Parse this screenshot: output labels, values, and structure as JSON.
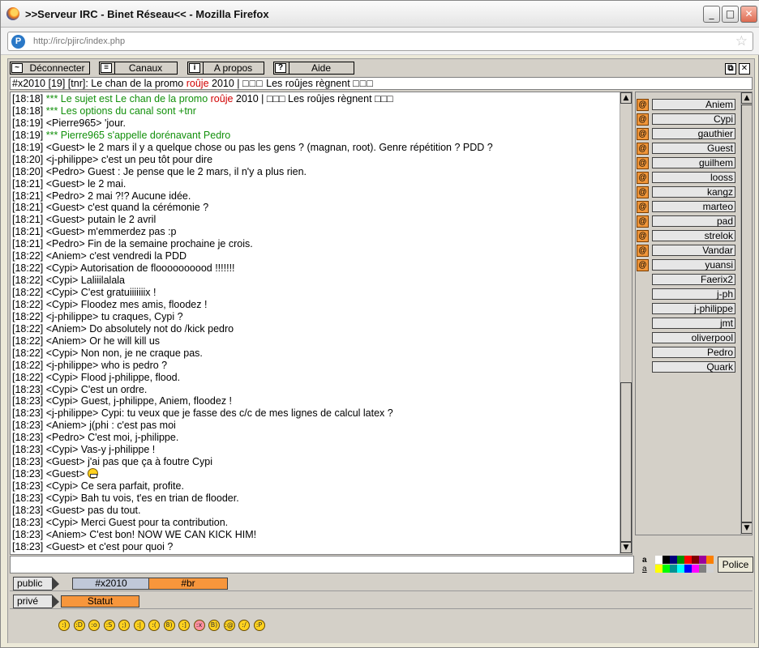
{
  "window": {
    "title": ">>Serveur IRC - Binet Réseau<< - Mozilla Firefox",
    "minimize": "_",
    "maximize": "□",
    "close": "✕"
  },
  "addressbar": {
    "favicon": "P",
    "url": "http://irc/pjirc/index.php",
    "bookmark_star": "☆"
  },
  "toolbar": {
    "buttons": [
      {
        "label": "Déconnecter",
        "icon": "~",
        "icon_name": "disconnect-icon"
      },
      {
        "label": "Canaux",
        "icon": "≡",
        "icon_name": "channels-icon"
      },
      {
        "label": "A propos",
        "icon": "i",
        "icon_name": "info-icon"
      },
      {
        "label": "Aide",
        "icon": "?",
        "icon_name": "help-icon"
      }
    ],
    "restore": "⧉",
    "close": "✕"
  },
  "topic": {
    "prefix": "#x2010 [19] [tnr]: Le chan de la promo ",
    "highlight": "roûje",
    "middle": " 2010 | ",
    "boxes1": "□□□",
    "suffix": " Les roûjes règnent ",
    "boxes2": "□□□"
  },
  "chat": {
    "lines": [
      {
        "time": "[18:18]",
        "text": "*** Le sujet est Le chan de la promo ",
        "highlight": "roûje",
        "text2": " 2010 | □□□ Les roûjes règnent □□□",
        "system": true
      },
      {
        "time": "[18:18]",
        "text": "*** Les options du canal sont +tnr",
        "system": true
      },
      {
        "time": "[18:19]",
        "text": "<Pierre965> 'jour."
      },
      {
        "time": "[18:19]",
        "text": "*** Pierre965 s'appelle dorénavant Pedro",
        "system": true
      },
      {
        "time": "[18:19]",
        "text": "<Guest> le 2 mars il y a quelque chose ou pas les gens ? (magnan, root). Genre répétition ? PDD ?"
      },
      {
        "time": "[18:20]",
        "text": "<j-philippe> c'est un peu tôt pour dire"
      },
      {
        "time": "[18:20]",
        "text": "<Pedro> Guest : Je pense que le 2 mars, il n'y a plus rien."
      },
      {
        "time": "[18:21]",
        "text": "<Guest> le 2 mai."
      },
      {
        "time": "[18:21]",
        "text": "<Pedro> 2 mai ?!? Aucune idée."
      },
      {
        "time": "[18:21]",
        "text": "<Guest> c'est quand la cérémonie ?"
      },
      {
        "time": "[18:21]",
        "text": "<Guest> putain le 2 avril"
      },
      {
        "time": "[18:21]",
        "text": "<Guest> m'emmerdez pas :p"
      },
      {
        "time": "[18:21]",
        "text": "<Pedro> Fin de la semaine prochaine je crois."
      },
      {
        "time": "[18:22]",
        "text": "<Aniem> c'est vendredi la PDD"
      },
      {
        "time": "[18:22]",
        "text": "<Cypi> Autorisation de floooooooood !!!!!!!"
      },
      {
        "time": "[18:22]",
        "text": "<Cypi> Laliiilalala"
      },
      {
        "time": "[18:22]",
        "text": "<Cypi> C'est gratuiiiiiiix !"
      },
      {
        "time": "[18:22]",
        "text": "<Cypi> Floodez mes amis, floodez !"
      },
      {
        "time": "[18:22]",
        "text": "<j-philippe> tu craques, Cypi ?"
      },
      {
        "time": "[18:22]",
        "text": "<Aniem> Do absolutely not do /kick pedro"
      },
      {
        "time": "[18:22]",
        "text": "<Aniem> Or he will kill us"
      },
      {
        "time": "[18:22]",
        "text": "<Cypi> Non non, je ne craque pas."
      },
      {
        "time": "[18:22]",
        "text": "<j-philippe> who is pedro ?"
      },
      {
        "time": "[18:22]",
        "text": "<Cypi> Flood j-philippe, flood."
      },
      {
        "time": "[18:23]",
        "text": "<Cypi> C'est un ordre."
      },
      {
        "time": "[18:23]",
        "text": "<Cypi> Guest, j-philippe, Aniem, floodez !"
      },
      {
        "time": "[18:23]",
        "text": "<j-philippe> Cypi: tu veux que je fasse des c/c de mes lignes de calcul latex ?"
      },
      {
        "time": "[18:23]",
        "text": "<Aniem> j(phi : c'est pas moi"
      },
      {
        "time": "[18:23]",
        "text": "<Pedro> C'est moi, j-philippe."
      },
      {
        "time": "[18:23]",
        "text": "<Cypi> Vas-y j-philippe !"
      },
      {
        "time": "[18:23]",
        "text": "<Guest> j'ai pas que ça à foutre Cypi"
      },
      {
        "time": "[18:23]",
        "text": "<Guest> ",
        "smiley": true
      },
      {
        "time": "[18:23]",
        "text": "<Cypi> Ce sera parfait, profite."
      },
      {
        "time": "[18:23]",
        "text": "<Cypi> Bah tu vois,  t'es en trian de flooder."
      },
      {
        "time": "[18:23]",
        "text": "<Guest> pas du tout."
      },
      {
        "time": "[18:23]",
        "text": "<Cypi> Merci Guest pour ta contribution."
      },
      {
        "time": "[18:23]",
        "text": "<Aniem> C'est bon! NOW WE CAN KICK HIM!"
      },
      {
        "time": "[18:23]",
        "text": "<Guest> et c'est pour quoi ?"
      }
    ]
  },
  "userlist": {
    "operator_symbol": "@",
    "users": [
      {
        "name": "Aniem",
        "op": true
      },
      {
        "name": "Cypi",
        "op": true
      },
      {
        "name": "gauthier",
        "op": true
      },
      {
        "name": "Guest",
        "op": true
      },
      {
        "name": "guilhem",
        "op": true
      },
      {
        "name": "looss",
        "op": true
      },
      {
        "name": "kangz",
        "op": true
      },
      {
        "name": "marteo",
        "op": true
      },
      {
        "name": "pad",
        "op": true
      },
      {
        "name": "strelok",
        "op": true
      },
      {
        "name": "Vandar",
        "op": true
      },
      {
        "name": "yuansi",
        "op": true
      },
      {
        "name": "Faerix2",
        "op": false
      },
      {
        "name": "j-ph",
        "op": false
      },
      {
        "name": "j-philippe",
        "op": false
      },
      {
        "name": "jmt",
        "op": false
      },
      {
        "name": "oliverpool",
        "op": false
      },
      {
        "name": "Pedro",
        "op": false
      },
      {
        "name": "Quark",
        "op": false
      }
    ]
  },
  "input": {
    "value": ""
  },
  "format": {
    "bold_label": "a",
    "underline_label": "a",
    "police_label": "Police",
    "colors": [
      "#ffffff",
      "#000000",
      "#00007f",
      "#009300",
      "#ff0000",
      "#7f0000",
      "#9c009c",
      "#fc7f00",
      "#ffff00",
      "#00fc00",
      "#009393",
      "#00ffff",
      "#0000fc",
      "#ff00ff",
      "#7f7f7f",
      "#d2d2d2"
    ]
  },
  "tabs": {
    "public_label": "public",
    "private_label": "privé",
    "public_tabs": [
      {
        "label": "#x2010",
        "color": "#c0c8d8"
      },
      {
        "label": "#br",
        "color": "#f7963c"
      }
    ],
    "private_tabs": [
      {
        "label": "Statut",
        "color": "#f7963c"
      }
    ]
  },
  "smileys": {
    "items": [
      ":)",
      ":D",
      ":o",
      ":S",
      ";)",
      ":|",
      ":(",
      "8)",
      ":]",
      ":x",
      "B)",
      ":@",
      ":/",
      ":P"
    ],
    "colors": [
      "#ffd21f",
      "#ffd21f",
      "#ffd21f",
      "#ffd21f",
      "#ffd21f",
      "#ffd21f",
      "#ffd21f",
      "#ffd21f",
      "#ffd21f",
      "#ff8fa0",
      "#ffd21f",
      "#ffd21f",
      "#ffd21f",
      "#ffd21f"
    ]
  }
}
